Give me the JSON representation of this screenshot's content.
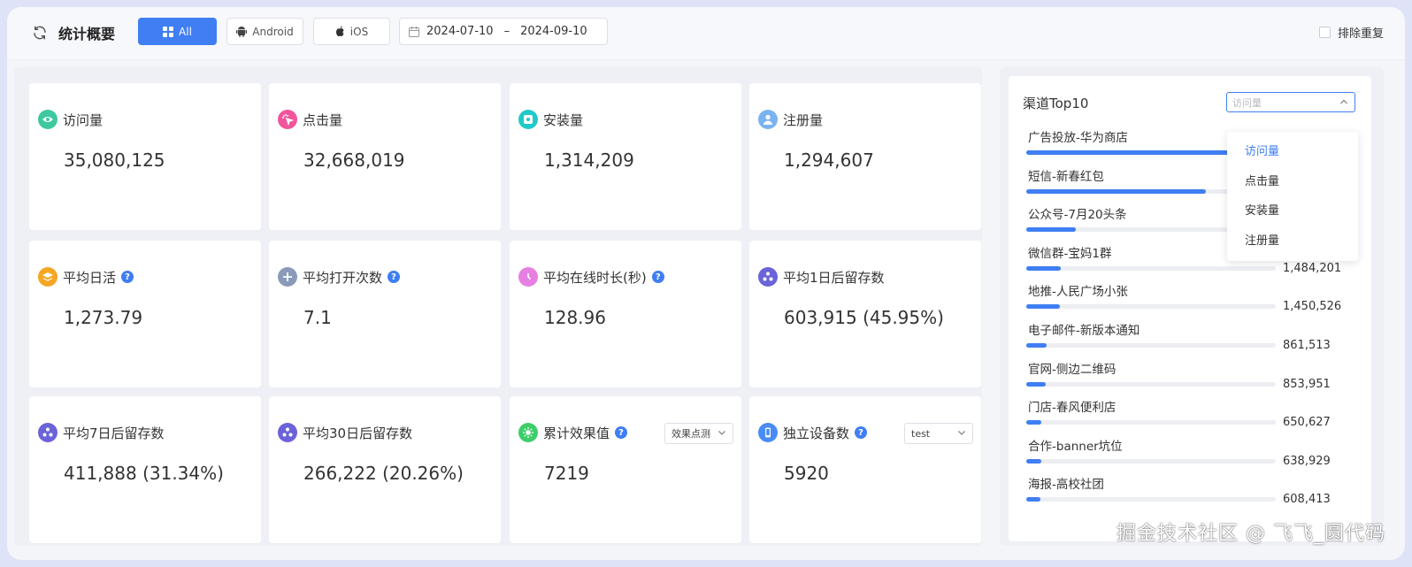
{
  "toolbar": {
    "title": "统计概要",
    "buttons": {
      "all": "All",
      "android": "Android",
      "ios": "iOS"
    },
    "date_start": "2024-07-10",
    "date_sep": "–",
    "date_end": "2024-09-10",
    "dedupe_label": "排除重复"
  },
  "cards": [
    {
      "label": "访问量",
      "value": "35,080,125",
      "icon": "eye-icon",
      "color": "#3dc8a0"
    },
    {
      "label": "点击量",
      "value": "32,668,019",
      "icon": "click-icon",
      "color": "#f2559c"
    },
    {
      "label": "安装量",
      "value": "1,314,209",
      "icon": "install-icon",
      "color": "#21c8c8"
    },
    {
      "label": "注册量",
      "value": "1,294,607",
      "icon": "user-icon",
      "color": "#7ab3ef"
    },
    {
      "label": "平均日活",
      "value": "1,273.79",
      "icon": "layers-icon",
      "color": "#f5a623",
      "help": "?"
    },
    {
      "label": "平均打开次数",
      "value": "7.1",
      "icon": "plus-icon",
      "color": "#8a9ab8",
      "help": "?"
    },
    {
      "label": "平均在线时长(秒)",
      "value": "128.96",
      "icon": "clock-icon",
      "color": "#e77fe3",
      "help": "?"
    },
    {
      "label": "平均1日后留存数",
      "value": "603,915 (45.95%)",
      "icon": "retention-icon",
      "color": "#6b63d8"
    },
    {
      "label": "平均7日后留存数",
      "value": "411,888 (31.34%)",
      "icon": "retention-icon",
      "color": "#6b63d8"
    },
    {
      "label": "平均30日后留存数",
      "value": "266,222 (20.26%)",
      "icon": "retention-icon",
      "color": "#6b63d8"
    },
    {
      "label": "累计效果值",
      "value": "7219",
      "icon": "effect-icon",
      "color": "#3dce6a",
      "help": "?",
      "select": "效果点测"
    },
    {
      "label": "独立设备数",
      "value": "5920",
      "icon": "device-icon",
      "color": "#4a8cf5",
      "help": "?",
      "select": "test"
    }
  ],
  "channel": {
    "title": "渠道Top10",
    "select_placeholder": "访问量",
    "items": [
      {
        "name": "广告投放-华为商店",
        "value": "",
        "fill": 0.82
      },
      {
        "name": "短信-新春红包",
        "value": "",
        "fill": 0.72
      },
      {
        "name": "公众号-7月20头条",
        "value": "",
        "fill": 0.2
      },
      {
        "name": "微信群-宝妈1群",
        "value": "1,484,201",
        "fill": 0.14
      },
      {
        "name": "地推-人民广场小张",
        "value": "1,450,526",
        "fill": 0.135
      },
      {
        "name": "电子邮件-新版本通知",
        "value": "861,513",
        "fill": 0.08
      },
      {
        "name": "官网-侧边二维码",
        "value": "853,951",
        "fill": 0.079
      },
      {
        "name": "门店-春风便利店",
        "value": "650,627",
        "fill": 0.06
      },
      {
        "name": "合作-banner坑位",
        "value": "638,929",
        "fill": 0.059
      },
      {
        "name": "海报-高校社团",
        "value": "608,413",
        "fill": 0.057
      }
    ]
  },
  "dropdown": {
    "options": [
      "访问量",
      "点击量",
      "安装量",
      "注册量"
    ],
    "selected": 0
  },
  "watermark": "掘金技术社区 @ 飞飞_圆代码",
  "colors": {
    "accent": "#3f7ef3"
  }
}
